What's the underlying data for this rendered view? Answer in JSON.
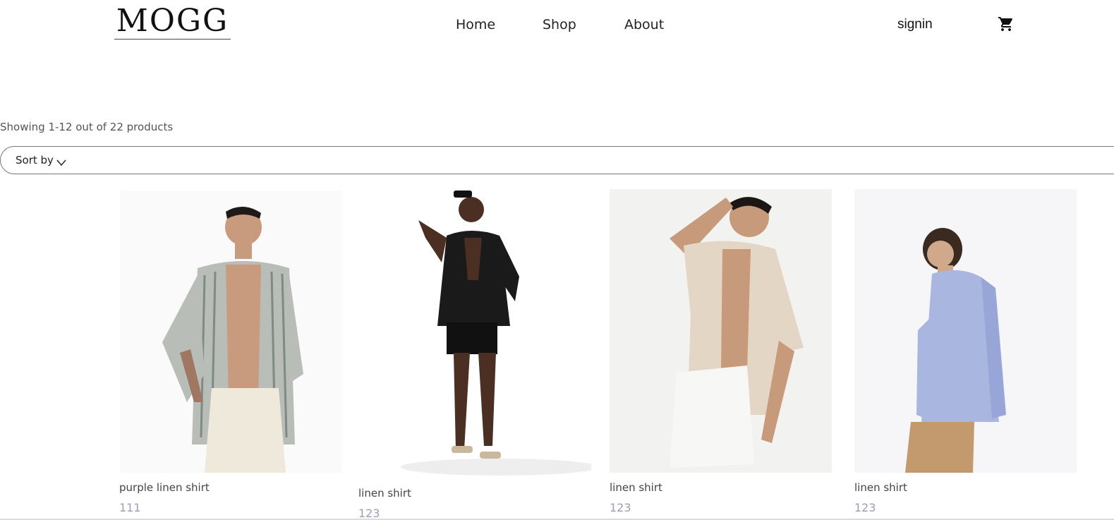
{
  "header": {
    "logo": "MOGG",
    "nav": [
      "Home",
      "Shop",
      "About"
    ],
    "signin": "signin",
    "cart_icon": "shopping-cart-icon"
  },
  "listing": {
    "showing": "Showing 1-12 out of 22 products",
    "sort_label": "Sort by",
    "sort_icon": "chevron-down-icon"
  },
  "products": [
    {
      "name": "purple linen shirt",
      "price": "111"
    },
    {
      "name": "linen shirt",
      "price": "123"
    },
    {
      "name": "linen shirt",
      "price": "123"
    },
    {
      "name": "linen shirt",
      "price": "123"
    }
  ],
  "colors": {
    "price": "#9a9fb4",
    "text": "#222222",
    "border": "#777777"
  }
}
